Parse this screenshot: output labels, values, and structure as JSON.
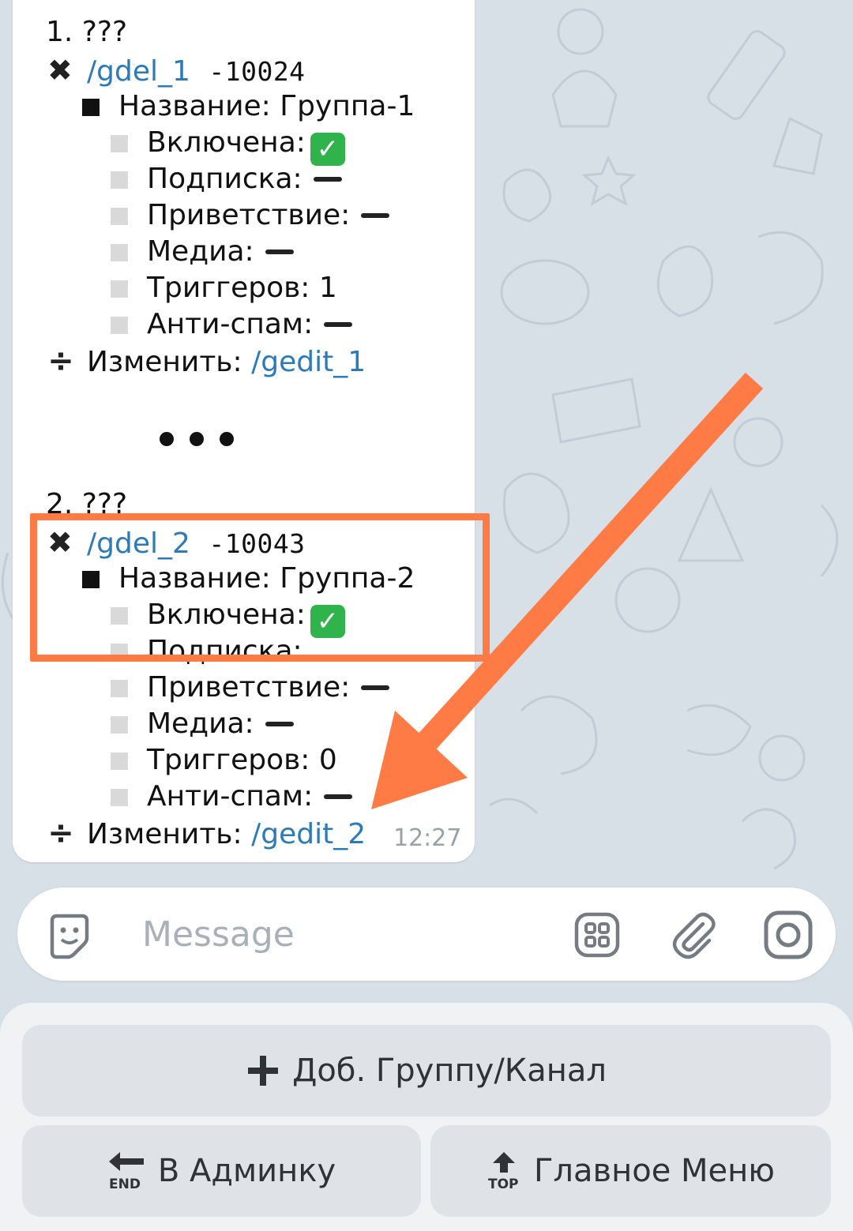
{
  "groups": [
    {
      "header": "1. ???",
      "del_link": "/gdel_1",
      "id_text": "-10024",
      "name": "Название: Группа-1",
      "enabled_label": "Включена:",
      "enabled_check": "✓",
      "subscription_label": "Подписка:",
      "greeting_label": "Приветствие:",
      "media_label": "Медиа:",
      "triggers": "Триггеров: 1",
      "antispam_label": "Анти-спам:",
      "edit_label": "Изменить:",
      "edit_link": "/gedit_1"
    },
    {
      "header": "2. ???",
      "del_link": "/gdel_2",
      "id_text": "-10043",
      "name": "Название: Группа-2",
      "enabled_label": "Включена:",
      "enabled_check": "✓",
      "subscription_label": "Подписка:",
      "greeting_label": "Приветствие:",
      "media_label": "Медиа:",
      "triggers": "Триггеров: 0",
      "antispam_label": "Анти-спам:",
      "edit_label": "Изменить:",
      "edit_link": "/gedit_2"
    }
  ],
  "timestamp": "12:27",
  "input": {
    "placeholder": "Message"
  },
  "keyboard": {
    "add_group": "Доб. Группу/Канал",
    "admin": "В Админку",
    "main_menu": "Главное Меню",
    "end_badge": "END",
    "top_badge": "TOP"
  },
  "colors": {
    "link": "#2c7bb8",
    "highlight": "#ff7b45",
    "check": "#2fb34a"
  }
}
